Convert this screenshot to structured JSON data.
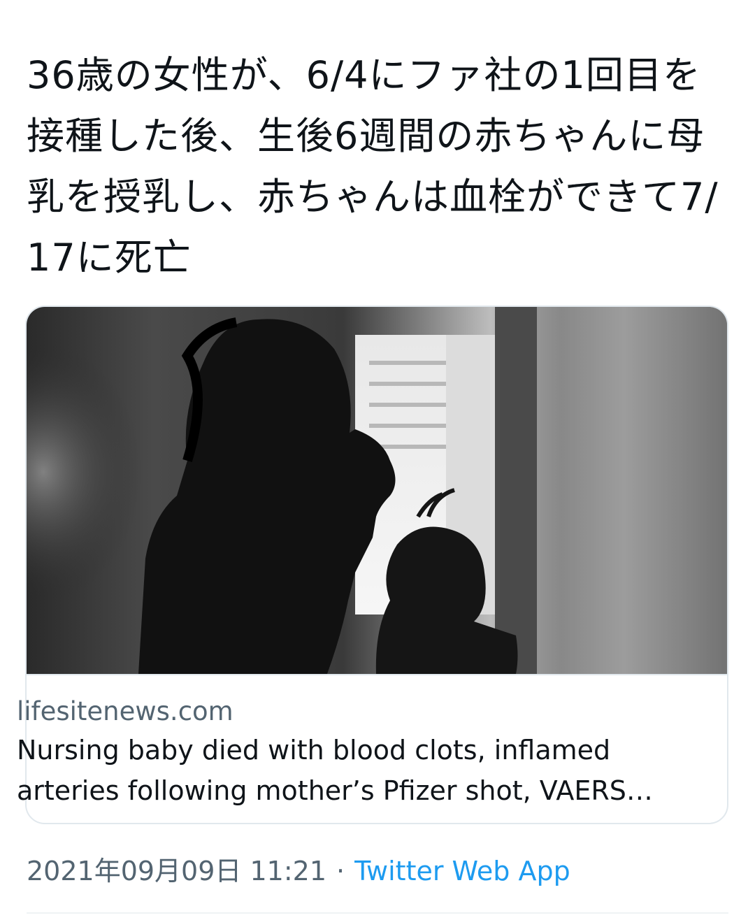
{
  "tweet": {
    "text": "36歳の女性が、6/4にファ社の1回目を接種した後、生後6週間の赤ちゃんに母乳を授乳し、赤ちゃんは血栓ができて7/17に死亡"
  },
  "card": {
    "image_icon": "photo-woman-and-child-silhouette",
    "domain": "lifesitenews.com",
    "title": "Nursing baby died with blood clots, inflamed arteries following mother’s Pfizer shot, VAERS…"
  },
  "meta": {
    "timestamp": "2021年09月09日 11:21",
    "separator": "·",
    "source": "Twitter Web App"
  },
  "colors": {
    "text": "#0f1419",
    "secondary": "#536471",
    "link": "#1d9bf0",
    "border": "#e1e8ed"
  }
}
